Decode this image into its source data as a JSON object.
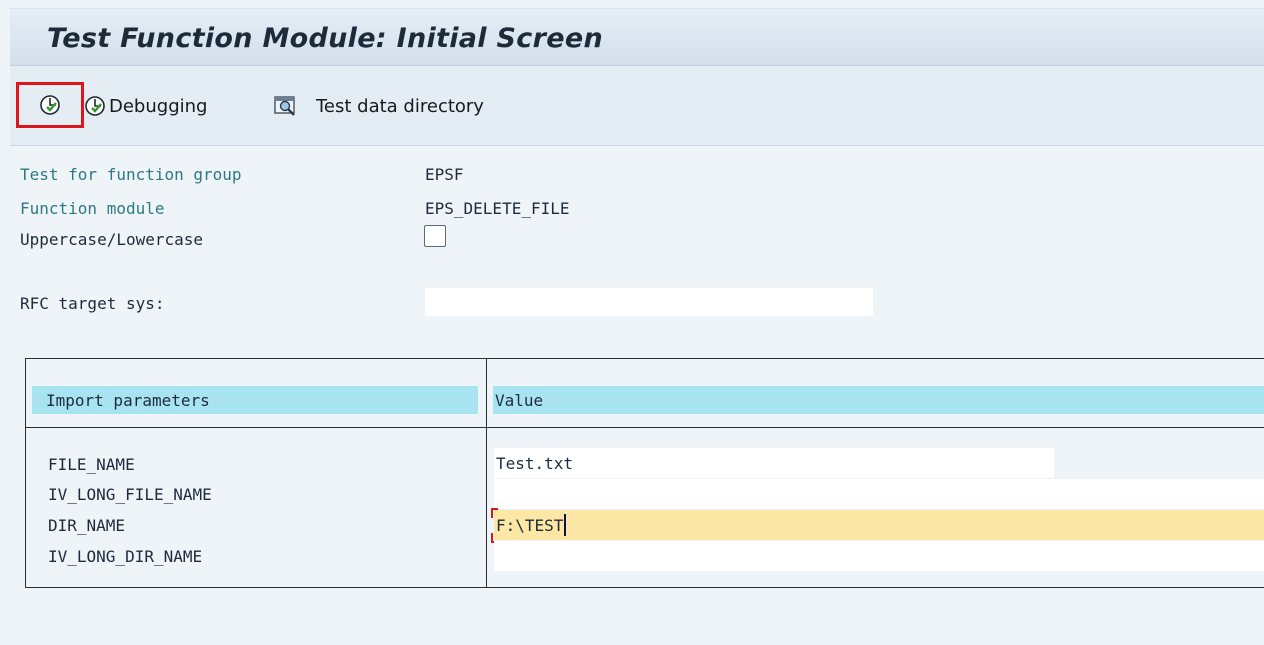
{
  "title": "Test Function Module: Initial Screen",
  "toolbar": {
    "execute_icon": "execute-icon",
    "debugging_label": "Debugging",
    "debugging_icon": "execute-icon",
    "test_data_directory_label": "Test data directory",
    "test_data_directory_icon": "test-data-directory-icon"
  },
  "header_fields": {
    "function_group_label": "Test for function group",
    "function_group_value": "EPSF",
    "function_module_label": "Function module",
    "function_module_value": "EPS_DELETE_FILE",
    "case_label": "Uppercase/Lowercase",
    "case_checked": false,
    "rfc_label": "RFC target sys:",
    "rfc_value": ""
  },
  "parameters": {
    "header": {
      "name": "Import parameters",
      "value": "Value"
    },
    "rows": [
      {
        "name": "FILE_NAME",
        "value": "Test.txt"
      },
      {
        "name": "IV_LONG_FILE_NAME",
        "value": ""
      },
      {
        "name": "DIR_NAME",
        "value": "F:\\TEST"
      },
      {
        "name": "IV_LONG_DIR_NAME",
        "value": ""
      }
    ]
  },
  "colors": {
    "highlight_box": "#e0141b",
    "table_header": "#a7e3f1",
    "active_field": "#fce7a5",
    "label_teal": "#2d7a7f"
  }
}
